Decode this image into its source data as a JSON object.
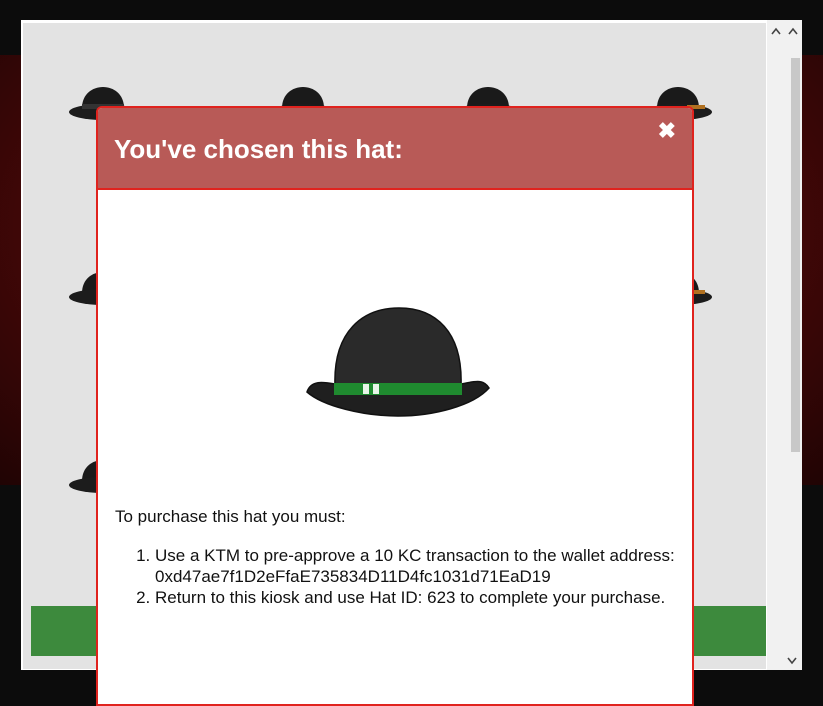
{
  "scrollbar": {
    "up_icon": "chevron-up-icon",
    "down_icon": "chevron-down-icon"
  },
  "modal": {
    "title": "You've chosen this hat:",
    "close_glyph": "✖",
    "hat_band_color": "#1f8a2f",
    "intro": "To purchase this hat you must:",
    "steps": [
      "Use a KTM to pre-approve a 10 KC transaction to the wallet address: 0xd47ae7f1D2eFfaE735834D11D4fc1031d71EaD19",
      "Return to this kiosk and use Hat ID: 623 to complete your purchase."
    ]
  },
  "colors": {
    "header_bg": "#b85a57",
    "modal_border": "#e0231e",
    "strip_green": "#3d8a3d"
  }
}
